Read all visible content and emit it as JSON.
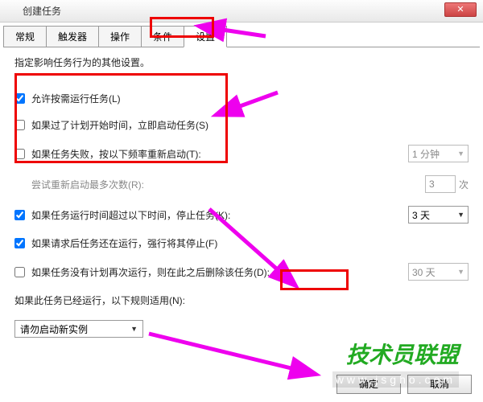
{
  "window": {
    "title": "创建任务"
  },
  "tabs": [
    "常规",
    "触发器",
    "操作",
    "条件",
    "设置"
  ],
  "active_tab": 4,
  "description": "指定影响任务行为的其他设置。",
  "options": {
    "allow_demand": {
      "label": "允许按需运行任务(L)",
      "checked": true
    },
    "run_if_missed": {
      "label": "如果过了计划开始时间，立即启动任务(S)",
      "checked": false
    },
    "restart_fail": {
      "label": "如果任务失败，按以下频率重新启动(T):",
      "checked": false,
      "interval": "1 分钟"
    },
    "retry_count": {
      "label": "尝试重新启动最多次数(R):",
      "value": "3",
      "suffix": "次"
    },
    "stop_longer": {
      "label": "如果任务运行时间超过以下时间，停止任务(K):",
      "checked": true,
      "value": "3 天"
    },
    "force_stop": {
      "label": "如果请求后任务还在运行，强行将其停止(F)",
      "checked": true
    },
    "delete_after": {
      "label": "如果任务没有计划再次运行，则在此之后删除该任务(D):",
      "checked": false,
      "value": "30 天"
    },
    "rule_label": "如果此任务已经运行，以下规则适用(N):",
    "rule_value": "请勿启动新实例"
  },
  "buttons": {
    "ok": "确定",
    "cancel": "取消"
  },
  "watermark": {
    "brand": "技术员联盟",
    "url": "www.jsgho.com"
  }
}
